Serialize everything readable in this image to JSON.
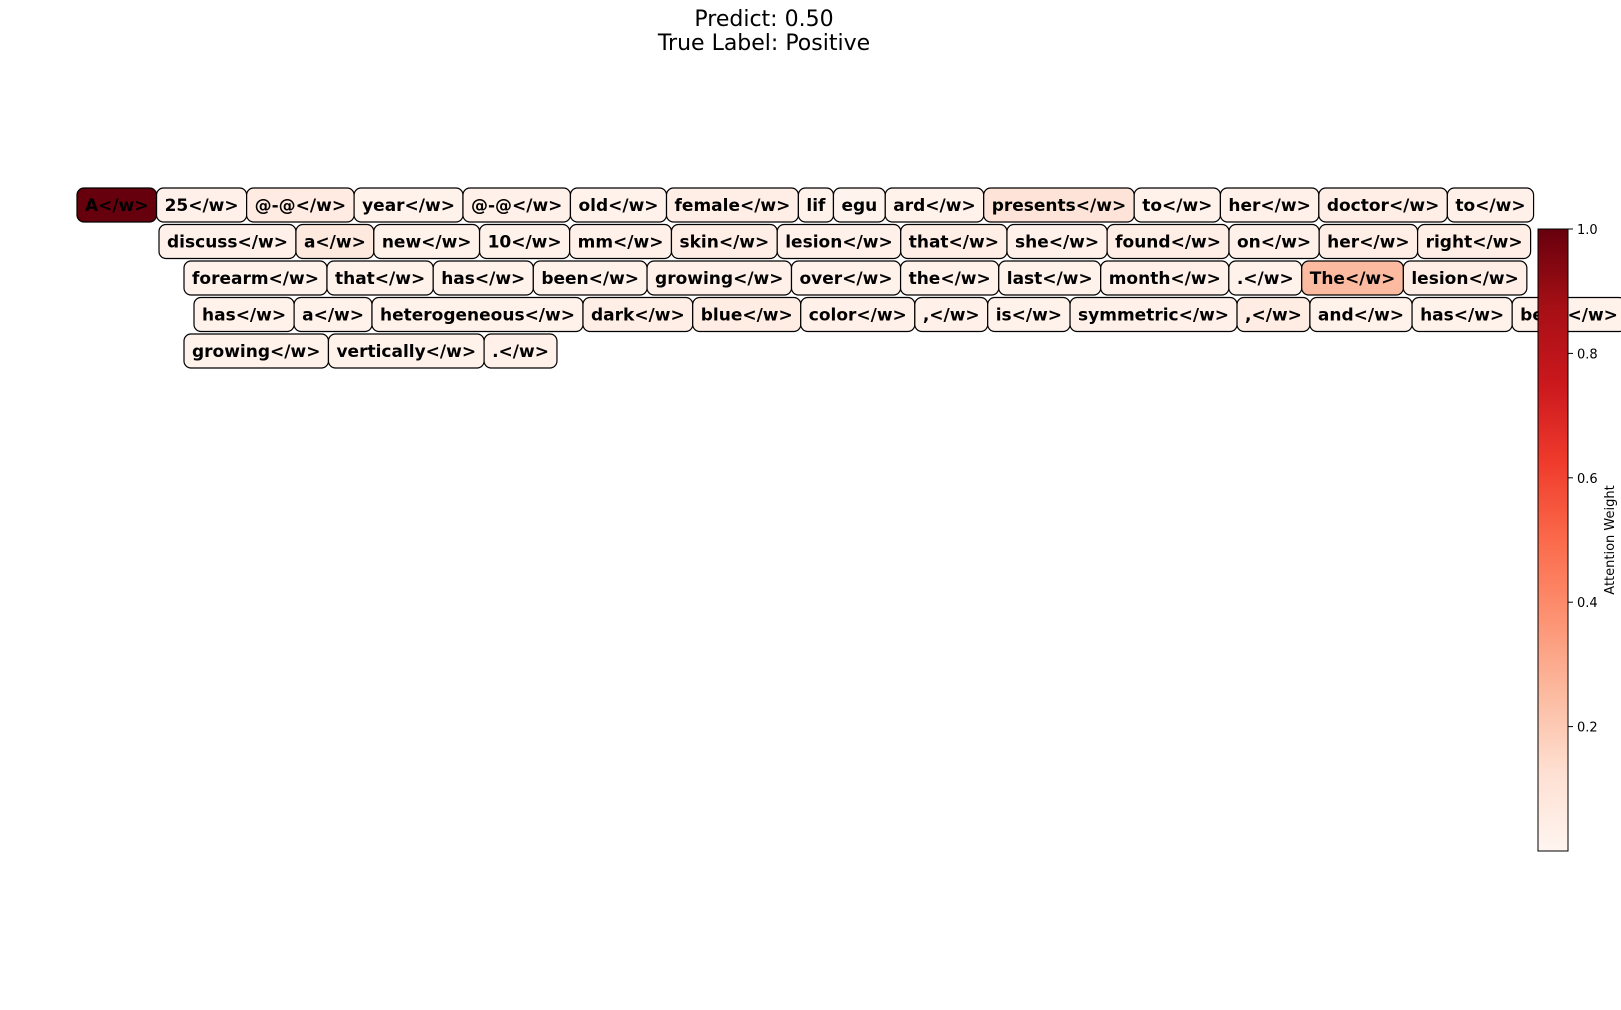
{
  "title": {
    "predict": "Predict: 0.50",
    "true_label": "True Label: Positive"
  },
  "colorbar": {
    "label": "Attention Weight",
    "ticks": [
      "0.2",
      "0.4",
      "0.6",
      "0.8",
      "1.0"
    ],
    "range": [
      0.0,
      1.0
    ],
    "colormap": "Reds",
    "colors": {
      "low": "#fff5f0",
      "high": "#67000d"
    }
  },
  "chart_data": {
    "type": "heatmap",
    "title": "Predict: 0.50\nTrue Label: Positive",
    "colorbar_label": "Attention Weight",
    "vmin": 0.0,
    "vmax": 1.0,
    "lines": [
      [
        {
          "text": "A</w>",
          "weight": 1.0
        },
        {
          "text": "25</w>",
          "weight": 0.03
        },
        {
          "text": "@-@</w>",
          "weight": 0.06
        },
        {
          "text": "year</w>",
          "weight": 0.02
        },
        {
          "text": "@-@</w>",
          "weight": 0.03
        },
        {
          "text": "old</w>",
          "weight": 0.02
        },
        {
          "text": "female</w>",
          "weight": 0.04
        },
        {
          "text": "lif",
          "weight": 0.02
        },
        {
          "text": "egu",
          "weight": 0.01
        },
        {
          "text": "ard</w>",
          "weight": 0.02
        },
        {
          "text": "presents</w>",
          "weight": 0.1
        },
        {
          "text": "to</w>",
          "weight": 0.02
        },
        {
          "text": "her</w>",
          "weight": 0.03
        },
        {
          "text": "doctor</w>",
          "weight": 0.04
        },
        {
          "text": "to</w>",
          "weight": 0.03
        }
      ],
      [
        {
          "text": "discuss</w>",
          "weight": 0.03
        },
        {
          "text": "a</w>",
          "weight": 0.07
        },
        {
          "text": "new</w>",
          "weight": 0.02
        },
        {
          "text": "10</w>",
          "weight": 0.02
        },
        {
          "text": "mm</w>",
          "weight": 0.03
        },
        {
          "text": "skin</w>",
          "weight": 0.04
        },
        {
          "text": "lesion</w>",
          "weight": 0.03
        },
        {
          "text": "that</w>",
          "weight": 0.04
        },
        {
          "text": "she</w>",
          "weight": 0.03
        },
        {
          "text": "found</w>",
          "weight": 0.04
        },
        {
          "text": "on</w>",
          "weight": 0.03
        },
        {
          "text": "her</w>",
          "weight": 0.04
        },
        {
          "text": "right</w>",
          "weight": 0.04
        }
      ],
      [
        {
          "text": "forearm</w>",
          "weight": 0.02
        },
        {
          "text": "that</w>",
          "weight": 0.02
        },
        {
          "text": "has</w>",
          "weight": 0.02
        },
        {
          "text": "been</w>",
          "weight": 0.02
        },
        {
          "text": "growing</w>",
          "weight": 0.03
        },
        {
          "text": "over</w>",
          "weight": 0.02
        },
        {
          "text": "the</w>",
          "weight": 0.02
        },
        {
          "text": "last</w>",
          "weight": 0.02
        },
        {
          "text": "month</w>",
          "weight": 0.03
        },
        {
          "text": ".</w>",
          "weight": 0.02
        },
        {
          "text": "The</w>",
          "weight": 0.25
        },
        {
          "text": "lesion</w>",
          "weight": 0.04
        }
      ],
      [
        {
          "text": "has</w>",
          "weight": 0.02
        },
        {
          "text": "a</w>",
          "weight": 0.02
        },
        {
          "text": "heterogeneous</w>",
          "weight": 0.02
        },
        {
          "text": "dark</w>",
          "weight": 0.04
        },
        {
          "text": "blue</w>",
          "weight": 0.05
        },
        {
          "text": "color</w>",
          "weight": 0.03
        },
        {
          "text": ",</w>",
          "weight": 0.03
        },
        {
          "text": "is</w>",
          "weight": 0.02
        },
        {
          "text": "symmetric</w>",
          "weight": 0.03
        },
        {
          "text": ",</w>",
          "weight": 0.05
        },
        {
          "text": "and</w>",
          "weight": 0.02
        },
        {
          "text": "has</w>",
          "weight": 0.02
        },
        {
          "text": "been</w>",
          "weight": 0.02
        }
      ],
      [
        {
          "text": "growing</w>",
          "weight": 0.02
        },
        {
          "text": "vertically</w>",
          "weight": 0.02
        },
        {
          "text": ".</w>",
          "weight": 0.03
        }
      ]
    ]
  }
}
